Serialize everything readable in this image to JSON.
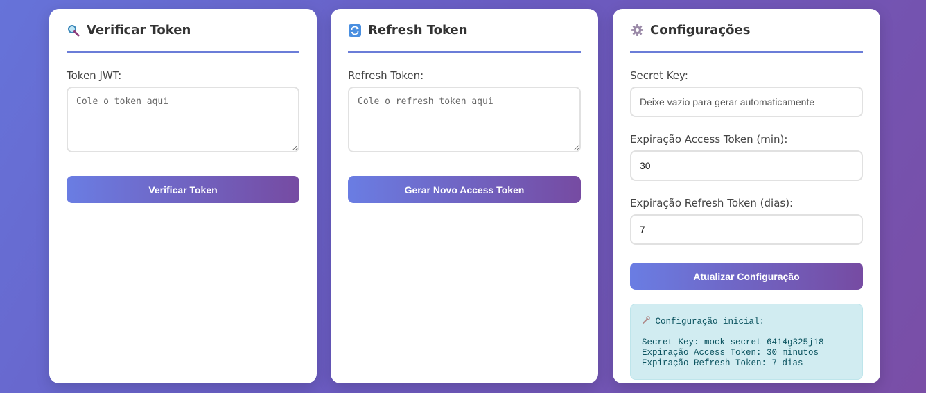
{
  "verify": {
    "icon": "magnifier-icon",
    "title": "Verificar Token",
    "token_label": "Token JWT:",
    "token_placeholder": "Cole o token aqui",
    "button": "Verificar Token"
  },
  "refresh": {
    "icon": "refresh-icon",
    "title": "Refresh Token",
    "token_label": "Refresh Token:",
    "token_placeholder": "Cole o refresh token aqui",
    "button": "Gerar Novo Access Token"
  },
  "config": {
    "icon": "gear-icon",
    "title": "Configurações",
    "secret_label": "Secret Key:",
    "secret_placeholder": "Deixe vazio para gerar automaticamente",
    "access_label": "Expiração Access Token (min):",
    "access_value": "30",
    "refresh_label": "Expiração Refresh Token (dias):",
    "refresh_value": "7",
    "button": "Atualizar Configuração",
    "info": {
      "heading": "Configuração inicial:",
      "heading_icon": "wrench-icon",
      "lines": [
        "Secret Key: mock-secret-6414g325j18",
        "Expiração Access Token: 30 minutos",
        "Expiração Refresh Token: 7 dias"
      ]
    }
  },
  "colors": {
    "accent_start": "#6a7de3",
    "accent_end": "#764ba2",
    "info_bg": "#d1ecf1",
    "info_text": "#0c5460"
  }
}
